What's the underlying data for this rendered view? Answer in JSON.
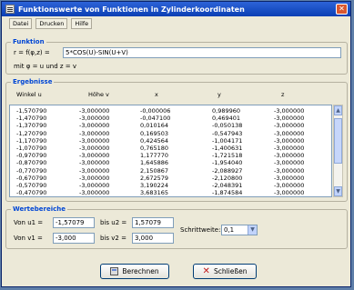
{
  "window": {
    "title": "Funktionswerte von Funktionen in Zylinderkoordinaten"
  },
  "menu": {
    "items": [
      "Datei",
      "Drucken",
      "Hilfe"
    ]
  },
  "function_group": {
    "title": "Funktion",
    "r_label": "r = f(φ,z) =",
    "r_value": "5*COS(U)-SIN(U+V)",
    "mapping": "mit   φ = u  und z = v"
  },
  "results": {
    "title": "Ergebnisse",
    "headers": [
      "Winkel u",
      "Höhe v",
      "x",
      "y",
      "z"
    ],
    "rows": [
      [
        "-1,570790",
        "-3,000000",
        "-0,000006",
        "0,989960",
        "-3,000000"
      ],
      [
        "-1,470790",
        "-3,000000",
        "-0,047100",
        "0,469401",
        "-3,000000"
      ],
      [
        "-1,370790",
        "-3,000000",
        "0,010164",
        "-0,050138",
        "-3,000000"
      ],
      [
        "-1,270790",
        "-3,000000",
        "0,169503",
        "-0,547943",
        "-3,000000"
      ],
      [
        "-1,170790",
        "-3,000000",
        "0,424564",
        "-1,004171",
        "-3,000000"
      ],
      [
        "-1,070790",
        "-3,000000",
        "0,765180",
        "-1,400631",
        "-3,000000"
      ],
      [
        "-0,970790",
        "-3,000000",
        "1,177770",
        "-1,721518",
        "-3,000000"
      ],
      [
        "-0,870790",
        "-3,000000",
        "1,645886",
        "-1,954040",
        "-3,000000"
      ],
      [
        "-0,770790",
        "-3,000000",
        "2,150867",
        "-2,088927",
        "-3,000000"
      ],
      [
        "-0,670790",
        "-3,000000",
        "2,672579",
        "-2,120800",
        "-3,000000"
      ],
      [
        "-0,570790",
        "-3,000000",
        "3,190224",
        "-2,048391",
        "-3,000000"
      ],
      [
        "-0,470790",
        "-3,000000",
        "3,683165",
        "-1,874584",
        "-3,000000"
      ]
    ]
  },
  "range": {
    "title": "Wertebereiche",
    "u1_label": "Von u1 =",
    "u1_value": "-1,57079",
    "u2_label": "bis  u2 =",
    "u2_value": "1,57079",
    "v1_label": "Von v1 =",
    "v1_value": "-3,000",
    "v2_label": "bis  v2 =",
    "v2_value": "3,000",
    "step_label": "Schrittweite:",
    "step_value": "0,1"
  },
  "buttons": {
    "calculate": "Berechnen",
    "close": "Schließen"
  }
}
